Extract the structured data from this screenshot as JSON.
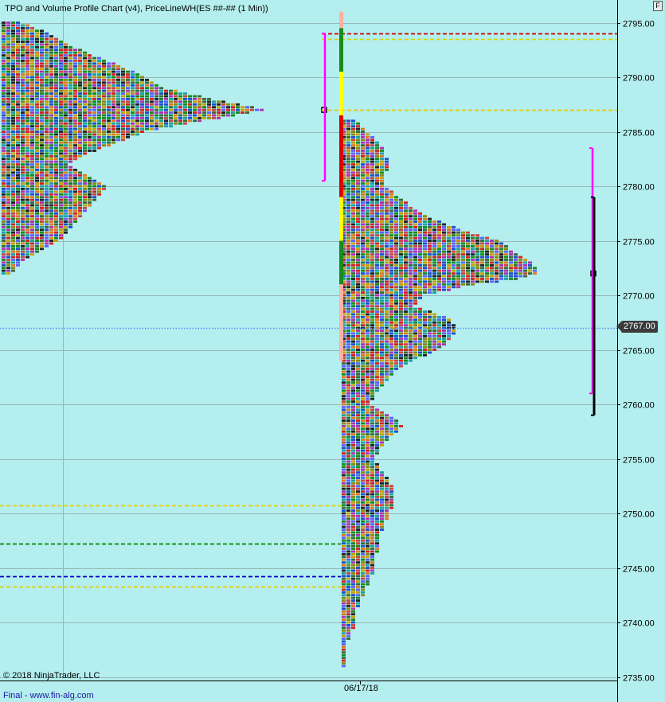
{
  "chart": {
    "title": "TPO and Volume Profile Chart (v4), PriceLineWH(ES ##-## (1 Min))",
    "copyright": "© 2018 NinjaTrader, LLC",
    "footer": "Final - www.fin-alg.com",
    "corner_button": "F",
    "current_price_label": "2767.00",
    "date_label": "06/17/18"
  },
  "chart_data": {
    "type": "bar",
    "y_axis": {
      "min": 2735,
      "max": 2796,
      "tick_values": [
        2735,
        2740,
        2745,
        2750,
        2755,
        2760,
        2765,
        2770,
        2775,
        2780,
        2785,
        2790,
        2795
      ],
      "tick_labels": [
        "2735.00",
        "2740.00",
        "2745.00",
        "2750.00",
        "2755.00",
        "2760.00",
        "2765.00",
        "2770.00",
        "2775.00",
        "2780.00",
        "2785.00",
        "2790.00",
        "2795.00"
      ]
    },
    "x_axis": {
      "tick_labels": [
        "06/17/18"
      ]
    },
    "current_price": 2767.0,
    "grid": true,
    "horizontal_levels": [
      {
        "price": 2794.0,
        "color": "#cc0000",
        "style": "dashed",
        "extent": "right"
      },
      {
        "price": 2793.5,
        "color": "#d8d800",
        "style": "dashed",
        "extent": "right"
      },
      {
        "price": 2787.0,
        "color": "#e8c800",
        "style": "dashed",
        "extent": "right"
      },
      {
        "price": 2750.75,
        "color": "#e8d000",
        "style": "dashed",
        "extent": "left"
      },
      {
        "price": 2747.25,
        "color": "#008800",
        "style": "dashed",
        "extent": "left"
      },
      {
        "price": 2744.25,
        "color": "#0000cc",
        "style": "dashed",
        "extent": "left"
      },
      {
        "price": 2743.25,
        "color": "#e8d000",
        "style": "dashed",
        "extent": "left"
      },
      {
        "price": 2767.0,
        "color": "#5a8cff",
        "style": "dotted",
        "extent": "full"
      }
    ],
    "profiles": [
      {
        "session": "prior",
        "row_step": 0.25,
        "poc": 2787.0,
        "value_area_high": 2794.0,
        "value_area_low": 2780.5,
        "rows": [
          [
            2795.0,
            4
          ],
          [
            2794.0,
            10
          ],
          [
            2793.0,
            14
          ],
          [
            2792.0,
            19
          ],
          [
            2791.0,
            25
          ],
          [
            2790.0,
            30
          ],
          [
            2789.0,
            34
          ],
          [
            2788.0,
            44
          ],
          [
            2787.5,
            50
          ],
          [
            2787.0,
            55
          ],
          [
            2786.5,
            49
          ],
          [
            2786.0,
            42
          ],
          [
            2785.0,
            30
          ],
          [
            2784.0,
            24
          ],
          [
            2783.0,
            18
          ],
          [
            2782.0,
            14
          ],
          [
            2781.0,
            18
          ],
          [
            2780.0,
            22
          ],
          [
            2779.0,
            20
          ],
          [
            2778.0,
            18
          ],
          [
            2777.0,
            16
          ],
          [
            2776.0,
            14
          ],
          [
            2775.0,
            12
          ],
          [
            2774.0,
            8
          ],
          [
            2773.0,
            4
          ],
          [
            2772.0,
            2
          ]
        ]
      },
      {
        "session": "current",
        "row_step": 0.25,
        "poc": 2772.0,
        "value_area_high": 2783.5,
        "value_area_low": 2761.0,
        "rows": [
          [
            2786.0,
            3
          ],
          [
            2785.0,
            5
          ],
          [
            2784.0,
            8
          ],
          [
            2783.0,
            9
          ],
          [
            2782.0,
            10
          ],
          [
            2781.0,
            9
          ],
          [
            2780.0,
            9
          ],
          [
            2779.0,
            12
          ],
          [
            2778.0,
            15
          ],
          [
            2777.0,
            19
          ],
          [
            2776.0,
            25
          ],
          [
            2775.0,
            33
          ],
          [
            2774.0,
            36
          ],
          [
            2773.0,
            40
          ],
          [
            2772.0,
            41
          ],
          [
            2771.5,
            37
          ],
          [
            2771.0,
            28
          ],
          [
            2770.0,
            17
          ],
          [
            2769.0,
            15
          ],
          [
            2768.0,
            22
          ],
          [
            2767.0,
            24
          ],
          [
            2766.0,
            23
          ],
          [
            2765.0,
            20
          ],
          [
            2764.0,
            15
          ],
          [
            2763.0,
            11
          ],
          [
            2762.0,
            9
          ],
          [
            2761.0,
            7
          ],
          [
            2760.0,
            6
          ],
          [
            2759.0,
            10
          ],
          [
            2758.0,
            13
          ],
          [
            2757.0,
            10
          ],
          [
            2756.0,
            8
          ],
          [
            2755.0,
            7
          ],
          [
            2754.0,
            8
          ],
          [
            2753.0,
            10
          ],
          [
            2752.0,
            11
          ],
          [
            2751.0,
            11
          ],
          [
            2750.0,
            10
          ],
          [
            2749.0,
            9
          ],
          [
            2748.0,
            8
          ],
          [
            2747.0,
            8
          ],
          [
            2746.0,
            7
          ],
          [
            2745.0,
            7
          ],
          [
            2744.0,
            6
          ],
          [
            2743.0,
            5
          ],
          [
            2742.0,
            4
          ],
          [
            2741.0,
            3
          ],
          [
            2740.0,
            3
          ],
          [
            2739.0,
            2
          ],
          [
            2738.0,
            1
          ],
          [
            2737.0,
            1
          ],
          [
            2736.0,
            1
          ]
        ]
      }
    ],
    "range_bar_segments": [
      {
        "from": 2796.0,
        "to": 2793.5,
        "color": "#ffb0a0"
      },
      {
        "from": 2794.5,
        "to": 2790.5,
        "color": "#1a8a1a"
      },
      {
        "from": 2790.5,
        "to": 2786.5,
        "color": "#ffff00"
      },
      {
        "from": 2786.5,
        "to": 2779.0,
        "color": "#e00000"
      },
      {
        "from": 2779.0,
        "to": 2775.0,
        "color": "#ffff00"
      },
      {
        "from": 2775.0,
        "to": 2771.0,
        "color": "#1a8a1a"
      },
      {
        "from": 2771.0,
        "to": 2764.0,
        "color": "#ffb0a0"
      }
    ],
    "value_area_brackets": [
      {
        "profile": "prior",
        "high": 2794.0,
        "low": 2780.5,
        "color": "#ff00ff"
      },
      {
        "profile": "current",
        "high": 2783.5,
        "low": 2761.0,
        "color": "#ff00ff"
      },
      {
        "profile": "current_range",
        "high": 2779.0,
        "low": 2759.0,
        "color": "#000000"
      }
    ],
    "tpo_colors": [
      "#d62020",
      "#1a8a1a",
      "#1f4ecc",
      "#8a8a10",
      "#e07820",
      "#222222",
      "#b030b0",
      "#20a0a0",
      "#cc4444",
      "#3a6a3a",
      "#6060ff",
      "#c8a000"
    ]
  }
}
